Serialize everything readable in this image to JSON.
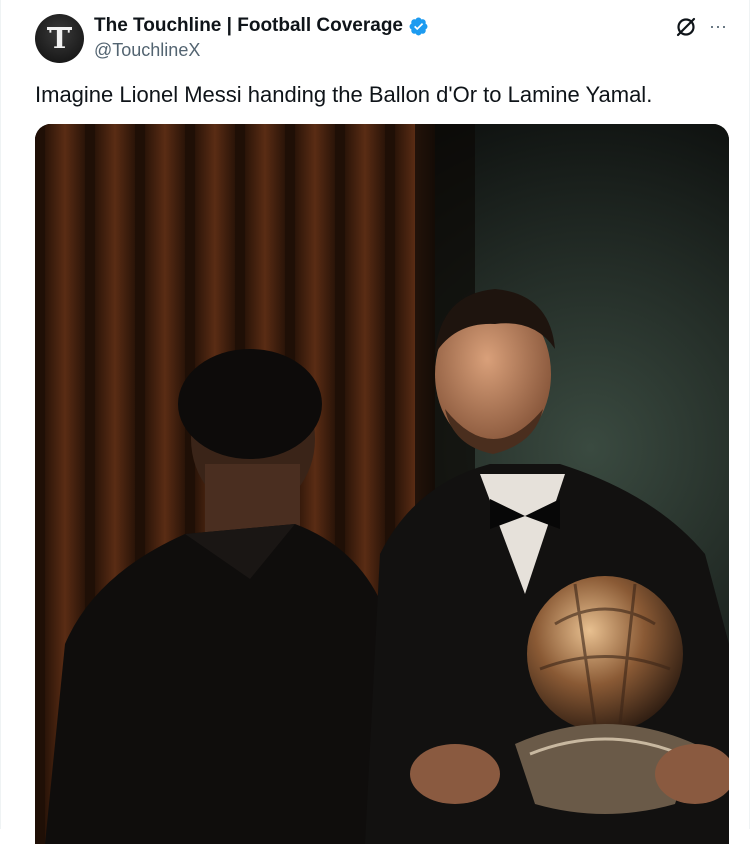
{
  "author": {
    "display_name": "The Touchline | Football Coverage",
    "handle": "@TouchlineX",
    "avatar_letter": "T",
    "verified": true,
    "verified_color": "#1d9bf0"
  },
  "tweet": {
    "text": "Imagine Lionel Messi handing the Ballon d'Or to Lamine Yamal."
  },
  "actions": {
    "grok_icon": "grok-icon",
    "more_icon": "more-icon",
    "more_glyph": "···"
  },
  "media": {
    "type": "photo",
    "description_icon": "photo"
  }
}
